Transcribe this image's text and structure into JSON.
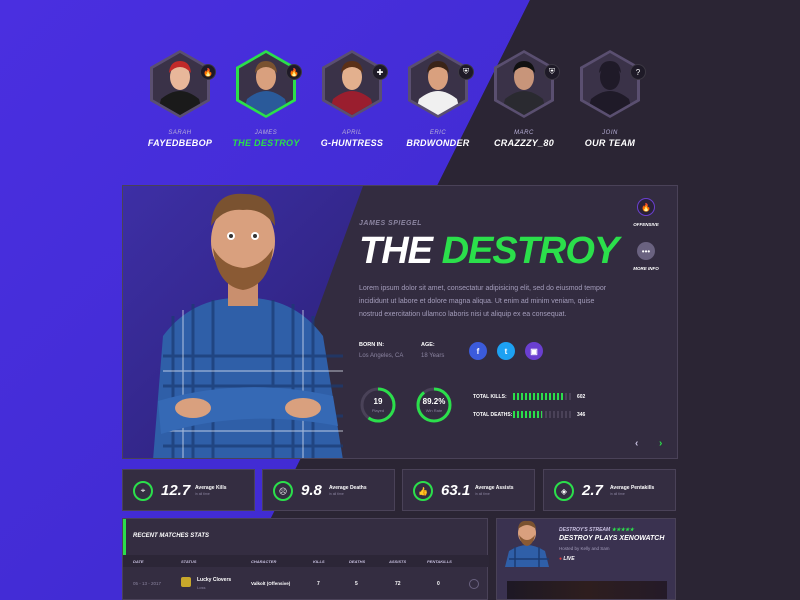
{
  "roster": [
    {
      "role": "SARAH",
      "name": "FAYEDBEBOP",
      "badge": "🔥",
      "active": false,
      "skin": "#e8b79a",
      "hair": "#c22a2a",
      "shirt": "#1a1a1a"
    },
    {
      "role": "JAMES",
      "name": "THE DESTROY",
      "badge": "🔥",
      "active": true,
      "skin": "#d9a07e",
      "hair": "#7a5230",
      "shirt": "#2a5a9a"
    },
    {
      "role": "APRIL",
      "name": "G-HUNTRESS",
      "badge": "✚",
      "active": false,
      "skin": "#e3b08e",
      "hair": "#5a3018",
      "shirt": "#9a1e2e"
    },
    {
      "role": "ERIC",
      "name": "BRDWONDER",
      "badge": "⛨",
      "active": false,
      "skin": "#d9a07e",
      "hair": "#3a2418",
      "shirt": "#f0f0f0"
    },
    {
      "role": "MARC",
      "name": "CRAZZZY_80",
      "badge": "⛨",
      "active": false,
      "skin": "#c8957a",
      "hair": "#111111",
      "shirt": "#2a2a30"
    },
    {
      "role": "JOIN",
      "name": "OUR TEAM",
      "badge": "?",
      "active": false,
      "skin": "#1f1a28",
      "hair": "#1f1a28",
      "shirt": "#1f1a28"
    }
  ],
  "hero": {
    "subtitle": "JAMES SPIEGEL",
    "title_white": "THE ",
    "title_green": "DESTROY",
    "description": "Lorem ipsum dolor sit amet, consectatur adipisicing elit, sed do eiusmod tempor incididunt ut labore et dolore magna aliqua. Ut enim ad minim veniam, quise nostrud exercitation ullamco laboris nisi ut aliquip ex ea consequat.",
    "born_label": "BORN IN:",
    "born_value": "Los Angeles, CA",
    "age_label": "AGE:",
    "age_value": "18 Years",
    "social": [
      {
        "icon": "facebook-icon",
        "glyph": "f",
        "color": "#3b5bdb"
      },
      {
        "icon": "twitter-icon",
        "glyph": "t",
        "color": "#1da1f2"
      },
      {
        "icon": "twitch-icon",
        "glyph": "▣",
        "color": "#6a3fd0"
      }
    ],
    "played": {
      "value": "19",
      "label": "Played",
      "fraction": 0.6
    },
    "win_rate": {
      "value": "89.2%",
      "label": "Win Rate",
      "fraction": 0.892
    },
    "total_kills": {
      "label": "TOTAL KILLS:",
      "value": "602",
      "fraction": 0.86
    },
    "total_deaths": {
      "label": "TOTAL DEATHS:",
      "value": "346",
      "fraction": 0.5
    },
    "side_offensive": "OFFENSIVE",
    "side_more": "MORE INFO",
    "prev": "‹",
    "next": "›"
  },
  "stats": [
    {
      "icon": "crosshair-icon",
      "glyph": "⌖",
      "value": "12.7",
      "label": "Average Kills",
      "sub": "in all time"
    },
    {
      "icon": "skull-icon",
      "glyph": "☹",
      "value": "9.8",
      "label": "Average Deaths",
      "sub": "in all time"
    },
    {
      "icon": "thumbs-up-icon",
      "glyph": "👍",
      "value": "63.1",
      "label": "Average Assists",
      "sub": "in all time"
    },
    {
      "icon": "target-icon",
      "glyph": "◈",
      "value": "2.7",
      "label": "Average Pentakills",
      "sub": "in all time"
    }
  ],
  "matches": {
    "title": "RECENT MATCHES STATS",
    "headers": [
      "DATE",
      "STATUS",
      "CHARACTER",
      "KILLS",
      "DEATHS",
      "ASSISTS",
      "PENTAKILLS"
    ],
    "row": {
      "date": "05 - 13 - 2017",
      "team": "Lucky Clovers",
      "status": "Loss",
      "character": "Valkolt (Offensive)",
      "kills": "7",
      "deaths": "5",
      "assists": "72",
      "pentakills": "0"
    }
  },
  "stream": {
    "label": "DESTROY'S STREAM",
    "stars": "★★★★★",
    "title": "DESTROY PLAYS XENOWATCH",
    "by": "Hosted by Kelly and Sam",
    "live": "LIVE",
    "live_dot": "●"
  },
  "colors": {
    "accent": "#2bdf4b",
    "purple": "#4a2fe0",
    "panel": "#332c40"
  }
}
